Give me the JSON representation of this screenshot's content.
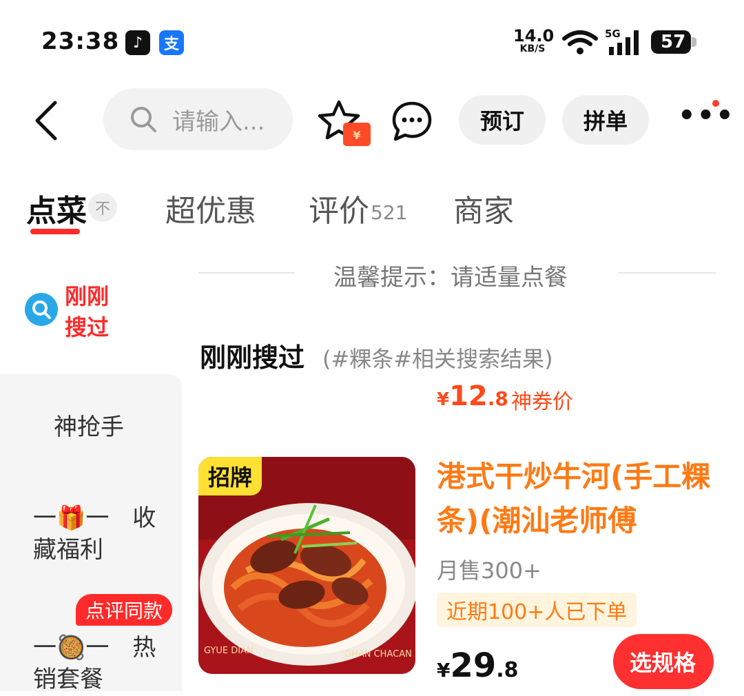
{
  "status": {
    "time": "23:38",
    "speed_value": "14.0",
    "speed_unit": "KB/S",
    "signal_label": "5G",
    "battery": "57"
  },
  "nav": {
    "search_placeholder": "请输入...",
    "reserve_label": "预订",
    "group_label": "拼单",
    "coupon_symbol": "¥"
  },
  "tabs": {
    "order": "点菜",
    "order_badge": "不",
    "deals": "超优惠",
    "reviews": "评价",
    "reviews_count": "521",
    "merchant": "商家"
  },
  "sidebar": {
    "recent": "刚刚搜过",
    "grab": "神抢手",
    "fav": "一🎁一　收藏福利",
    "tag": "点评同款",
    "hot": "一🥘一　热销套餐"
  },
  "content": {
    "tip": "温馨提示：请适量点餐",
    "section_title": "刚刚搜过",
    "section_sub": "(#粿条#相关搜索结果)",
    "coupon_price_currency": "¥",
    "coupon_price_int": "12",
    "coupon_price_dec": ".8",
    "coupon_label": "神券价"
  },
  "product": {
    "badge": "招牌",
    "name": "港式干炒牛河(手工粿条)(潮汕老师傅",
    "sales": "月售300+",
    "recent_orders": "近期100+人已下单",
    "currency": "¥",
    "price_int": "29",
    "price_dec": ".8",
    "spec_button": "选规格",
    "plate_text_left": "GYUE DIAN",
    "plate_text_right": "GHAN CHACAN"
  },
  "colors": {
    "accent_red": "#ff2a2a",
    "price_orange": "#ff7a14",
    "link_blue": "#29a8e8"
  }
}
